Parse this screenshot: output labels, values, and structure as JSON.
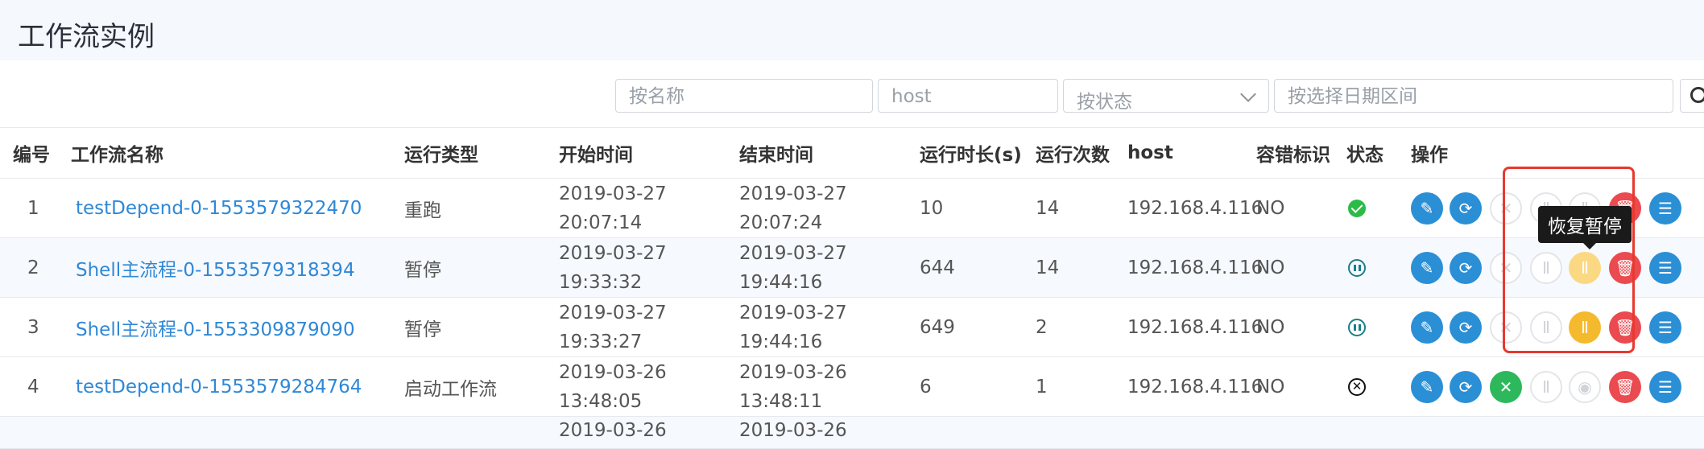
{
  "page": {
    "title": "工作流实例"
  },
  "filters": {
    "name_placeholder": "按名称",
    "host_placeholder": "host",
    "status_placeholder": "按状态",
    "date_placeholder": "按选择日期区间"
  },
  "table": {
    "headers": {
      "index": "编号",
      "name": "工作流名称",
      "run_type": "运行类型",
      "start_time": "开始时间",
      "end_time": "结束时间",
      "duration": "运行时长(s)",
      "run_count": "运行次数",
      "host": "host",
      "fault_tolerance": "容错标识",
      "status": "状态",
      "actions": "操作"
    },
    "rows": [
      {
        "index": "1",
        "name": "testDepend-0-1553579322470",
        "run_type": "重跑",
        "start_date": "2019-03-27",
        "start_clock": "20:07:14",
        "end_date": "2019-03-27",
        "end_clock": "20:07:24",
        "duration": "10",
        "run_count": "14",
        "host": "192.168.4.116",
        "fault_tolerance": "NO",
        "status_icon": "success-icon"
      },
      {
        "index": "2",
        "name": "Shell主流程-0-1553579318394",
        "run_type": "暂停",
        "start_date": "2019-03-27",
        "start_clock": "19:33:32",
        "end_date": "2019-03-27",
        "end_clock": "19:44:16",
        "duration": "644",
        "run_count": "14",
        "host": "192.168.4.116",
        "fault_tolerance": "NO",
        "status_icon": "paused-icon"
      },
      {
        "index": "3",
        "name": "Shell主流程-0-1553309879090",
        "run_type": "暂停",
        "start_date": "2019-03-27",
        "start_clock": "19:33:27",
        "end_date": "2019-03-27",
        "end_clock": "19:44:16",
        "duration": "649",
        "run_count": "2",
        "host": "192.168.4.116",
        "fault_tolerance": "NO",
        "status_icon": "paused-icon"
      },
      {
        "index": "4",
        "name": "testDepend-0-1553579284764",
        "run_type": "启动工作流",
        "start_date": "2019-03-26",
        "start_clock": "13:48:05",
        "end_date": "2019-03-26",
        "end_clock": "13:48:11",
        "duration": "6",
        "run_count": "1",
        "host": "192.168.4.116",
        "fault_tolerance": "NO",
        "status_icon": "failed-icon"
      },
      {
        "index": "",
        "name": "",
        "run_type": "",
        "start_date": "2019-03-26",
        "start_clock": "",
        "end_date": "2019-03-26",
        "end_clock": "",
        "duration": "",
        "run_count": "",
        "host": "",
        "fault_tolerance": "",
        "status_icon": ""
      }
    ]
  },
  "tooltip": {
    "text": "恢复暂停"
  },
  "colors": {
    "primary_blue": "#2b8fd6",
    "success_green": "#2db85c",
    "danger_red": "#ea4a50",
    "warning_yellow": "#f5b92d",
    "highlight_red": "#e8392f"
  },
  "icons": {
    "edit": "edit-icon",
    "rerun": "refresh-icon",
    "recover_failed": "close-circle-icon",
    "pause": "pause-icon",
    "recover_pause": "pause-resume-icon",
    "stop": "stop-icon",
    "delete": "trash-icon",
    "gantt": "gantt-icon"
  }
}
